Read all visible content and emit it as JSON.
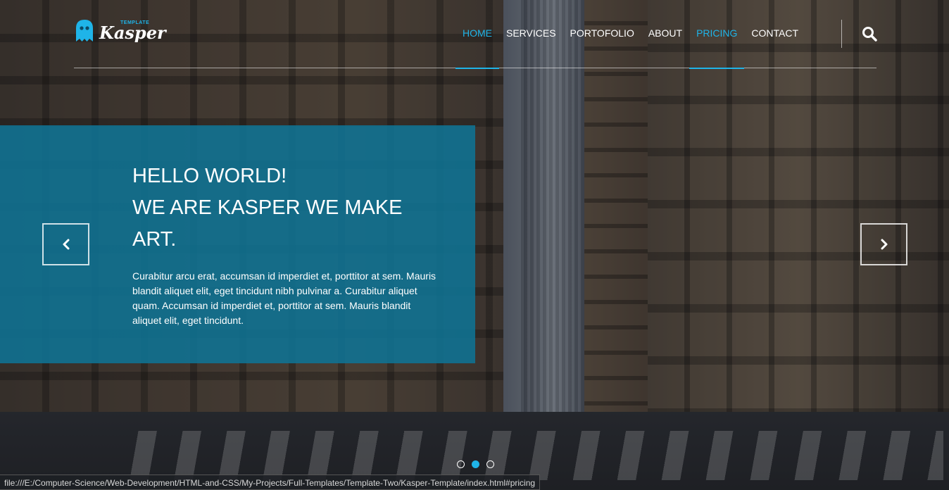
{
  "brand": {
    "logo_small": "TEMPLATE",
    "logo_main": "Kasper",
    "accent_color": "#1fb4e8"
  },
  "nav": {
    "items": [
      {
        "label": "HOME",
        "active": true
      },
      {
        "label": "SERVICES",
        "active": false
      },
      {
        "label": "PORTOFOLIO",
        "active": false
      },
      {
        "label": "ABOUT",
        "active": false
      },
      {
        "label": "PRICING",
        "active": true
      },
      {
        "label": "CONTACT",
        "active": false
      }
    ],
    "search_icon": "search-icon"
  },
  "hero": {
    "heading_line1": "HELLO WORLD!",
    "heading_line2": "WE ARE KASPER WE MAKE ART.",
    "body": "Curabitur arcu erat, accumsan id imperdiet et, porttitor at sem. Mauris blandit aliquet elit, eget tincidunt nibh pulvinar a. Curabitur aliquet quam. Accumsan id imperdiet et, porttitor at sem. Mauris blandit aliquet elit, eget tincidunt.",
    "panel_color": "#0f7394"
  },
  "carousel": {
    "prev_icon": "chevron-left-icon",
    "next_icon": "chevron-right-icon",
    "dots": [
      false,
      true,
      false
    ]
  },
  "status_bar": {
    "url": "file:///E:/Computer-Science/Web-Development/HTML-and-CSS/My-Projects/Full-Templates/Template-Two/Kasper-Template/index.html#pricing"
  }
}
